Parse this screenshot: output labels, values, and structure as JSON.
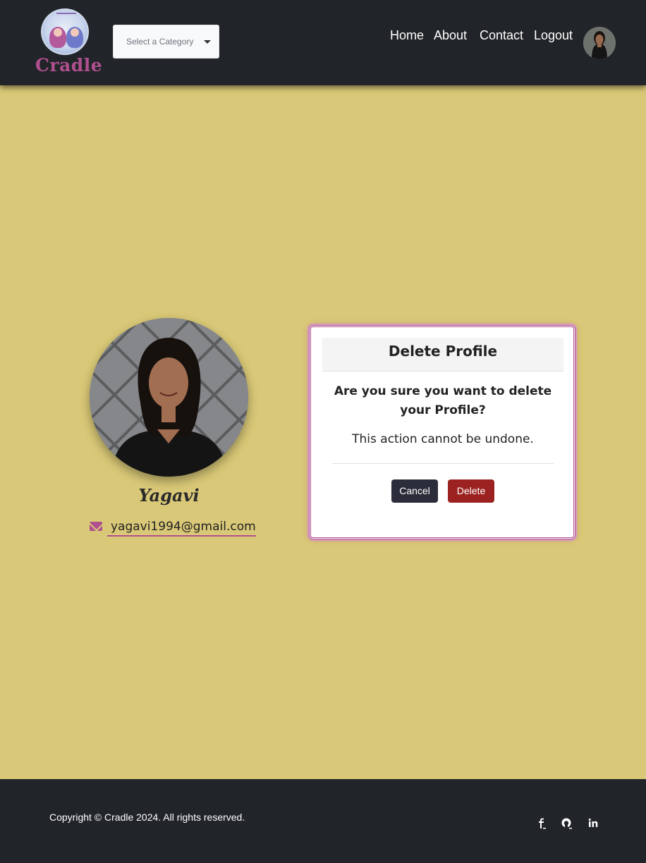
{
  "header": {
    "logo_text": "Cradle",
    "category_placeholder": "Select a Category",
    "nav": [
      "Home",
      "About",
      "Contact",
      "Logout"
    ]
  },
  "profile": {
    "name": "Yagavi",
    "email": "yagavi1994@gmail.com"
  },
  "modal": {
    "title": "Delete Profile",
    "question": "Are you sure you want to delete your Profile?",
    "note": "This action cannot be undone.",
    "cancel_label": "Cancel",
    "delete_label": "Delete"
  },
  "footer": {
    "copyright": "Copyright © Cradle 2024. All rights reserved."
  },
  "colors": {
    "background": "#d9c877",
    "navbar": "#212529",
    "accent": "#b04f8f",
    "delete": "#9c2222",
    "cancel": "#2b2e3a"
  },
  "icons": [
    "mail-icon",
    "facebook-icon",
    "github-icon",
    "linkedin-icon",
    "caret-down-icon"
  ]
}
